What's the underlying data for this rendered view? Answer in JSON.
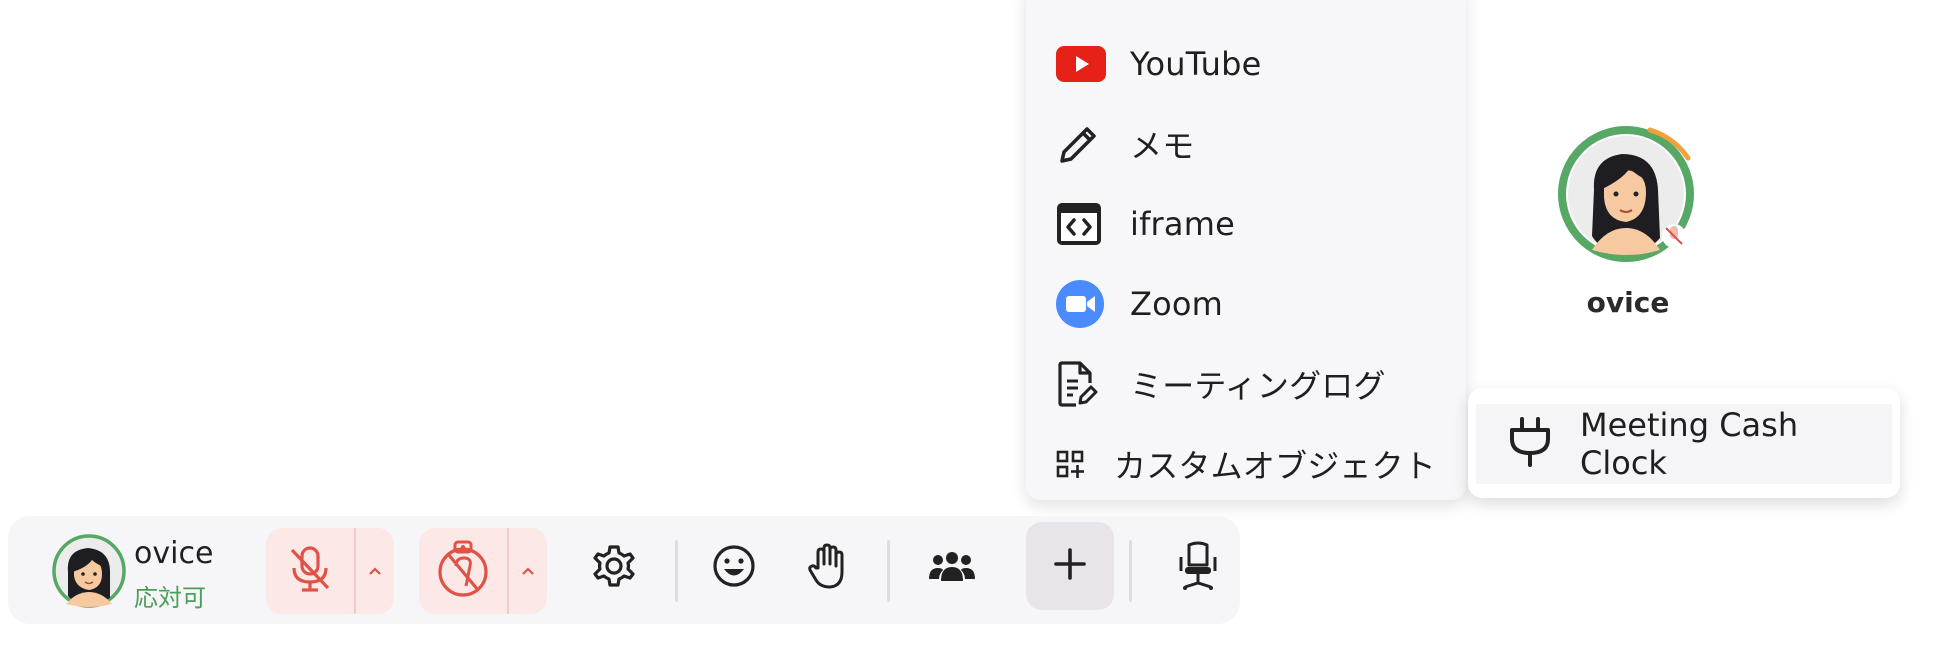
{
  "object_menu": {
    "items": [
      {
        "label": "YouTube",
        "icon": "youtube-icon"
      },
      {
        "label": "メモ",
        "icon": "pencil-icon"
      },
      {
        "label": "iframe",
        "icon": "iframe-icon"
      },
      {
        "label": "Zoom",
        "icon": "zoom-icon"
      },
      {
        "label": "ミーティングログ",
        "icon": "meeting-log-icon"
      },
      {
        "label": "カスタムオブジェクト",
        "icon": "custom-object-icon"
      }
    ]
  },
  "custom_submenu": {
    "items": [
      {
        "label": "Meeting Cash Clock",
        "icon": "plug-icon"
      }
    ]
  },
  "map_user": {
    "name": "ovice"
  },
  "toolbar": {
    "user_name": "ovice",
    "user_status": "応対可",
    "mic": {
      "state": "muted",
      "icon": "mic-off-icon"
    },
    "camera": {
      "state": "off",
      "icon": "camera-off-icon"
    },
    "icons": [
      "gear-icon",
      "emoji-icon",
      "raise-hand-icon",
      "people-icon",
      "plus-icon",
      "office-chair-icon"
    ]
  },
  "colors": {
    "accent_red": "#e05246",
    "status_green": "#4a9e5b",
    "youtube_red": "#e62117",
    "zoom_blue": "#4a8cff",
    "avatar_ring_green": "#57a765",
    "avatar_ring_orange": "#f0a03c"
  }
}
